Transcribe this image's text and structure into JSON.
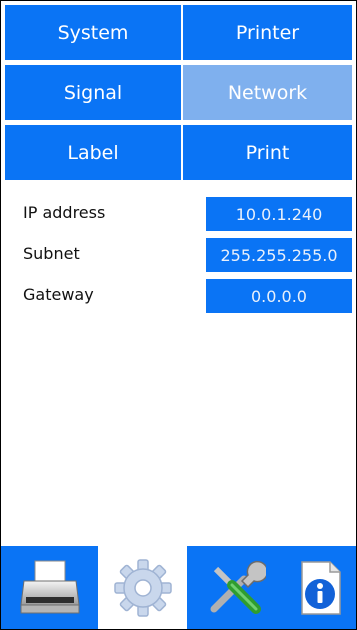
{
  "menu": {
    "items": [
      {
        "label": "System"
      },
      {
        "label": "Printer"
      },
      {
        "label": "Signal"
      },
      {
        "label": "Network",
        "active": true
      },
      {
        "label": "Label"
      },
      {
        "label": "Print"
      }
    ]
  },
  "network": {
    "ip_label": "IP address",
    "ip_value": "10.0.1.240",
    "subnet_label": "Subnet",
    "subnet_value": "255.255.255.0",
    "gateway_label": "Gateway",
    "gateway_value": "0.0.0.0"
  },
  "bottom_tabs": [
    {
      "icon": "printer-icon"
    },
    {
      "icon": "gear-icon",
      "active": true
    },
    {
      "icon": "tools-icon"
    },
    {
      "icon": "info-icon"
    }
  ],
  "colors": {
    "accent": "#0a74f5",
    "active_tab": "#7fb0ee",
    "background": "#ffffff"
  }
}
